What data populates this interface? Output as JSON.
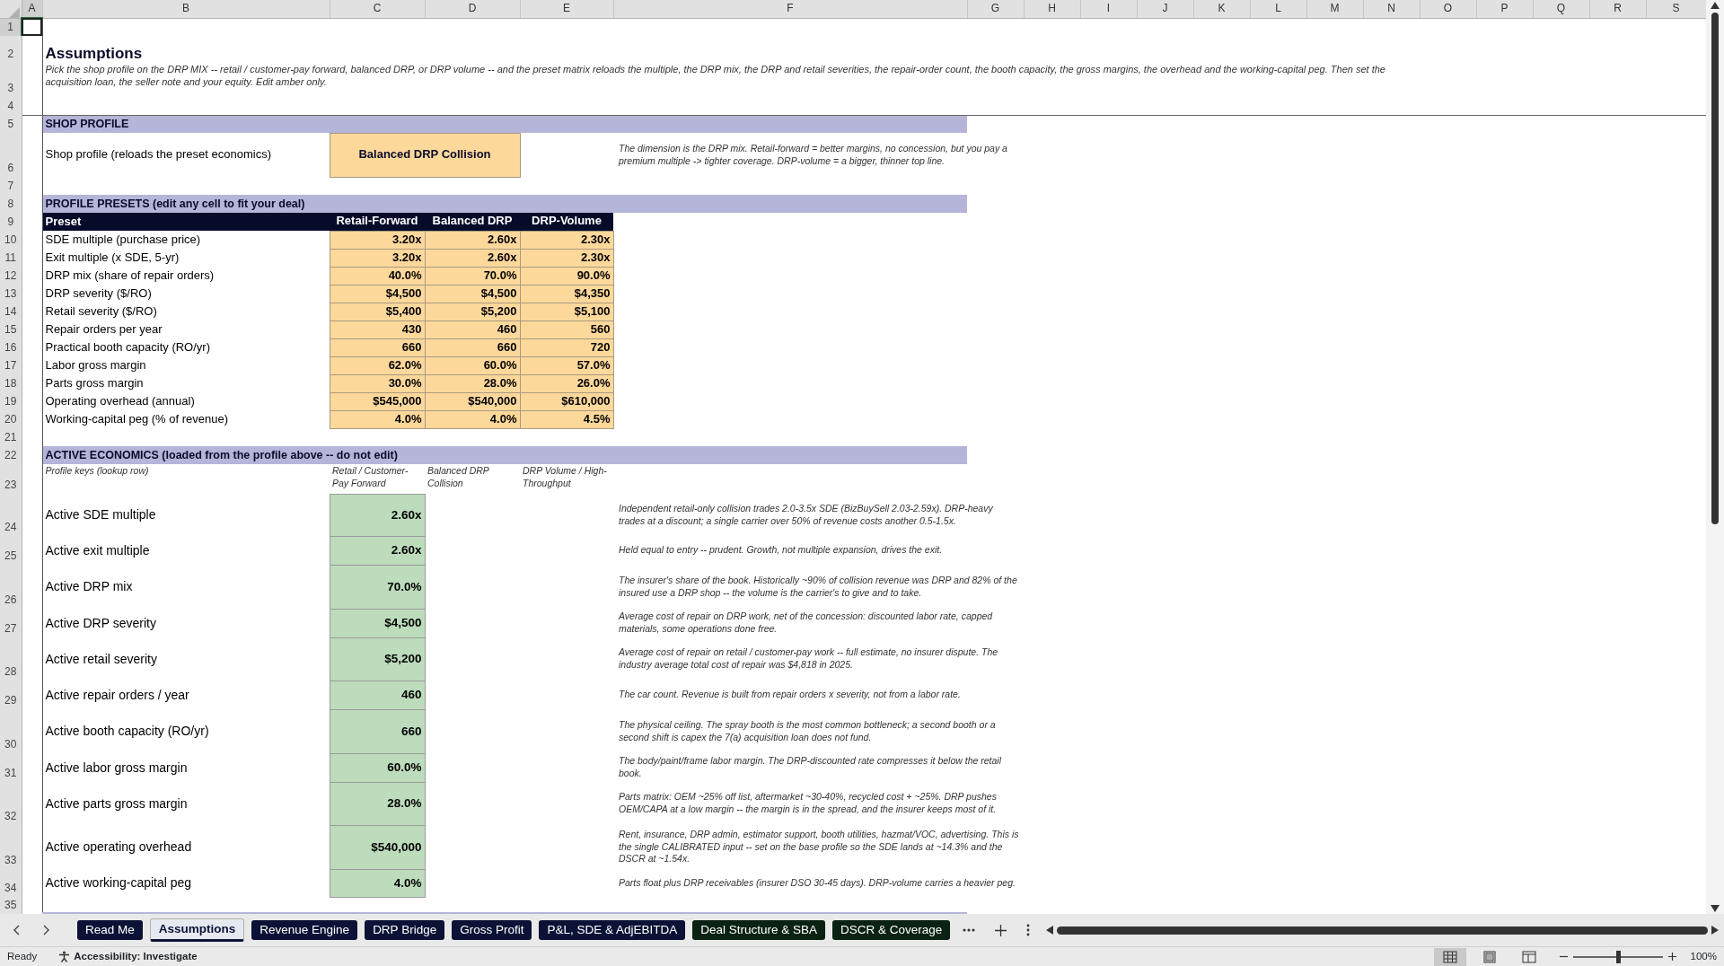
{
  "sheet": {
    "columns": [
      {
        "label": "A",
        "selected": true
      },
      {
        "label": "B",
        "selected": false
      },
      {
        "label": "C",
        "selected": false
      },
      {
        "label": "D",
        "selected": false
      },
      {
        "label": "E",
        "selected": false
      },
      {
        "label": "F",
        "selected": false
      },
      {
        "label": "G",
        "selected": false
      },
      {
        "label": "H",
        "selected": false
      },
      {
        "label": "I",
        "selected": false
      },
      {
        "label": "J",
        "selected": false
      },
      {
        "label": "K",
        "selected": false
      },
      {
        "label": "L",
        "selected": false
      },
      {
        "label": "M",
        "selected": false
      },
      {
        "label": "N",
        "selected": false
      },
      {
        "label": "O",
        "selected": false
      },
      {
        "label": "P",
        "selected": false
      },
      {
        "label": "Q",
        "selected": false
      },
      {
        "label": "R",
        "selected": false
      },
      {
        "label": "S",
        "selected": false
      }
    ],
    "rows": [
      {
        "label": "1",
        "selected": true
      },
      {
        "label": "2",
        "selected": false
      },
      {
        "label": "3",
        "selected": false
      },
      {
        "label": "4",
        "selected": false
      },
      {
        "label": "5",
        "selected": false
      },
      {
        "label": "6",
        "selected": false
      },
      {
        "label": "7",
        "selected": false
      },
      {
        "label": "8",
        "selected": false
      },
      {
        "label": "9",
        "selected": false
      },
      {
        "label": "10",
        "selected": false
      },
      {
        "label": "11",
        "selected": false
      },
      {
        "label": "12",
        "selected": false
      },
      {
        "label": "13",
        "selected": false
      },
      {
        "label": "14",
        "selected": false
      },
      {
        "label": "15",
        "selected": false
      },
      {
        "label": "16",
        "selected": false
      },
      {
        "label": "17",
        "selected": false
      },
      {
        "label": "18",
        "selected": false
      },
      {
        "label": "19",
        "selected": false
      },
      {
        "label": "20",
        "selected": false
      },
      {
        "label": "21",
        "selected": false
      },
      {
        "label": "22",
        "selected": false
      },
      {
        "label": "23",
        "selected": false
      },
      {
        "label": "24",
        "selected": false
      },
      {
        "label": "25",
        "selected": false
      },
      {
        "label": "26",
        "selected": false
      },
      {
        "label": "27",
        "selected": false
      },
      {
        "label": "28",
        "selected": false
      },
      {
        "label": "29",
        "selected": false
      },
      {
        "label": "30",
        "selected": false
      },
      {
        "label": "31",
        "selected": false
      },
      {
        "label": "32",
        "selected": false
      },
      {
        "label": "33",
        "selected": false
      },
      {
        "label": "34",
        "selected": false
      },
      {
        "label": "35",
        "selected": false
      }
    ]
  },
  "title": "Assumptions",
  "intro": "Pick the shop profile on the DRP MIX -- retail / customer-pay forward, balanced DRP, or DRP volume -- and the preset matrix reloads the multiple, the DRP mix, the DRP and retail severities, the repair-order count, the booth capacity, the gross margins, the overhead and the working-capital peg. Then set the acquisition loan, the seller note and your equity. Edit amber only.",
  "shop_profile": {
    "header": "SHOP PROFILE",
    "label": "Shop profile (reloads the preset economics)",
    "value": "Balanced DRP Collision",
    "note": "The dimension is the DRP mix. Retail-forward = better margins, no concession, but you pay a premium multiple -> tighter coverage. DRP-volume = a bigger, thinner top line."
  },
  "presets": {
    "header": "PROFILE PRESETS  (edit any cell to fit your deal)",
    "columns": [
      "Preset",
      "Retail-Forward",
      "Balanced DRP",
      "DRP-Volume"
    ],
    "rows": [
      {
        "label": "SDE multiple (purchase price)",
        "values": [
          "3.20x",
          "2.60x",
          "2.30x"
        ]
      },
      {
        "label": "Exit multiple (x SDE, 5-yr)",
        "values": [
          "3.20x",
          "2.60x",
          "2.30x"
        ]
      },
      {
        "label": "DRP mix (share of repair orders)",
        "values": [
          "40.0%",
          "70.0%",
          "90.0%"
        ]
      },
      {
        "label": "DRP severity ($/RO)",
        "values": [
          "$4,500",
          "$4,500",
          "$4,350"
        ]
      },
      {
        "label": "Retail severity ($/RO)",
        "values": [
          "$5,400",
          "$5,200",
          "$5,100"
        ]
      },
      {
        "label": "Repair orders per year",
        "values": [
          "430",
          "460",
          "560"
        ]
      },
      {
        "label": "Practical booth capacity (RO/yr)",
        "values": [
          "660",
          "660",
          "720"
        ]
      },
      {
        "label": "Labor gross margin",
        "values": [
          "62.0%",
          "60.0%",
          "57.0%"
        ]
      },
      {
        "label": "Parts gross margin",
        "values": [
          "30.0%",
          "28.0%",
          "26.0%"
        ]
      },
      {
        "label": "Operating overhead (annual)",
        "values": [
          "$545,000",
          "$540,000",
          "$610,000"
        ]
      },
      {
        "label": "Working-capital peg (% of revenue)",
        "values": [
          "4.0%",
          "4.0%",
          "4.5%"
        ]
      }
    ]
  },
  "active": {
    "header": "ACTIVE ECONOMICS  (loaded from the profile above -- do not edit)",
    "keys_label": "Profile keys (lookup row)",
    "keys": [
      "Retail / Customer-Pay Forward",
      "Balanced DRP Collision",
      "DRP Volume / High-Throughput"
    ],
    "rows": [
      {
        "label": "Active SDE multiple",
        "value": "2.60x",
        "note": "Independent retail-only collision trades 2.0-3.5x SDE (BizBuySell 2.03-2.59x). DRP-heavy trades at a discount; a single carrier over 50% of revenue costs another 0.5-1.5x."
      },
      {
        "label": "Active exit multiple",
        "value": "2.60x",
        "note": "Held equal to entry -- prudent. Growth, not multiple expansion, drives the exit."
      },
      {
        "label": "Active DRP mix",
        "value": "70.0%",
        "note": "The insurer's share of the book. Historically ~90% of collision revenue was DRP and 82% of the insured use a DRP shop -- the volume is the carrier's to give and to take."
      },
      {
        "label": "Active DRP severity",
        "value": "$4,500",
        "note": "Average cost of repair on DRP work, net of the concession: discounted labor rate, capped materials, some operations done free."
      },
      {
        "label": "Active retail severity",
        "value": "$5,200",
        "note": "Average cost of repair on retail / customer-pay work -- full estimate, no insurer dispute. The industry average total cost of repair was $4,818 in 2025."
      },
      {
        "label": "Active repair orders / year",
        "value": "460",
        "note": "The car count. Revenue is built from repair orders x severity, not from a labor rate."
      },
      {
        "label": "Active booth capacity (RO/yr)",
        "value": "660",
        "note": "The physical ceiling. The spray booth is the most common bottleneck; a second booth or a second shift is capex the 7(a) acquisition loan does not fund."
      },
      {
        "label": "Active labor gross margin",
        "value": "60.0%",
        "note": "The body/paint/frame labor margin. The DRP-discounted rate compresses it below the retail book."
      },
      {
        "label": "Active parts gross margin",
        "value": "28.0%",
        "note": "Parts matrix: OEM ~25% off list, aftermarket ~30-40%, recycled cost + ~25%. DRP pushes OEM/CAPA at a low margin -- the margin is in the spread, and the insurer keeps most of it."
      },
      {
        "label": "Active operating overhead",
        "value": "$540,000",
        "note": "Rent, insurance, DRP admin, estimator support, booth utilities, hazmat/VOC, advertising. This is the single CALIBRATED input -- set on the base profile so the SDE lands at ~14.3% and the DSCR at ~1.54x."
      },
      {
        "label": "Active working-capital peg",
        "value": "4.0%",
        "note": "Parts float plus DRP receivables (insurer DSO 30-45 days). DRP-volume carries a heavier peg."
      }
    ]
  },
  "sheet_tabs": [
    {
      "label": "Read Me",
      "selected": false,
      "color": "#0b1236"
    },
    {
      "label": "Assumptions",
      "selected": true,
      "color": "#0b1236"
    },
    {
      "label": "Revenue Engine",
      "selected": false,
      "color": "#0b1236"
    },
    {
      "label": "DRP Bridge",
      "selected": false,
      "color": "#0b1236"
    },
    {
      "label": "Gross Profit",
      "selected": false,
      "color": "#0b1236"
    },
    {
      "label": "P&L, SDE & AdjEBITDA",
      "selected": false,
      "color": "#0b1236"
    },
    {
      "label": "Deal Structure & SBA",
      "selected": false,
      "color": "#0a2212"
    },
    {
      "label": "DSCR & Coverage",
      "selected": false,
      "color": "#0a2212"
    }
  ],
  "status": {
    "mode": "Ready",
    "accessibility": "Accessibility: Investigate",
    "views": [
      {
        "kind": "normal",
        "selected": true
      },
      {
        "kind": "page-layout",
        "selected": false
      },
      {
        "kind": "page-break",
        "selected": false
      }
    ],
    "zoom": {
      "label": "100%",
      "level": 0.5
    }
  }
}
